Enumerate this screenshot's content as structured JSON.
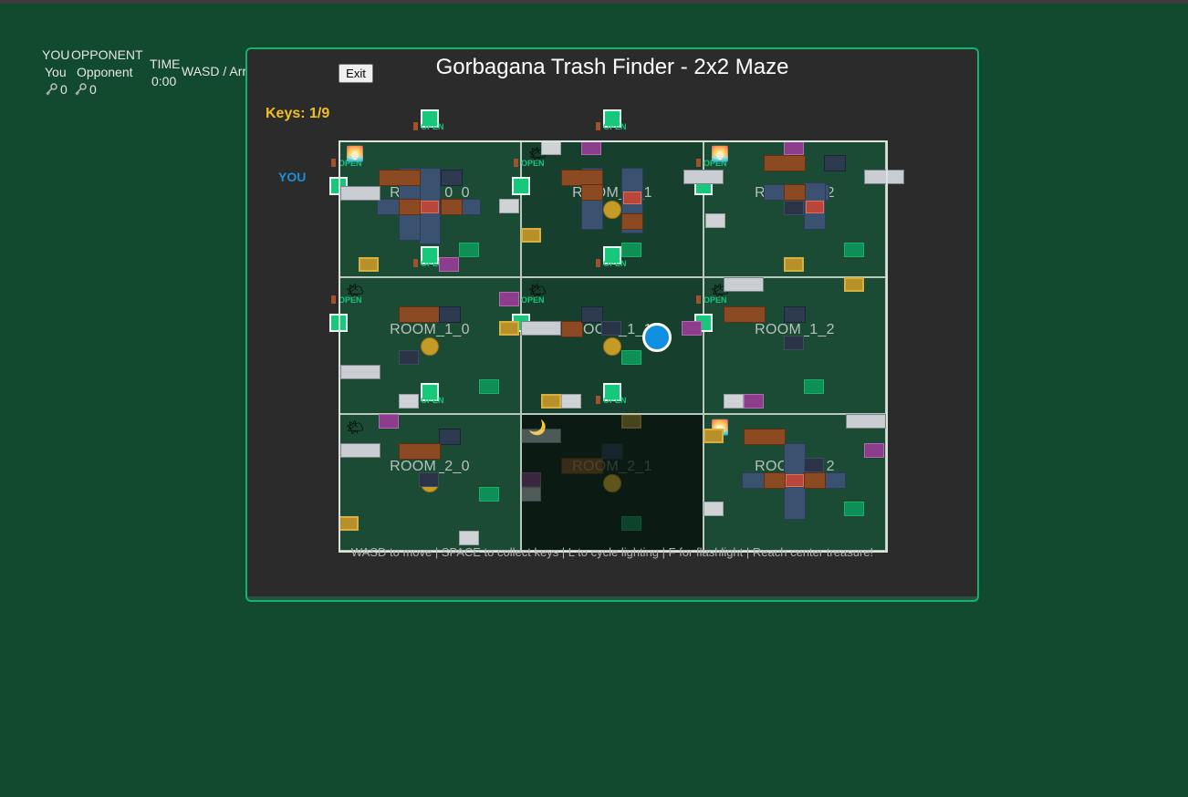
{
  "hud": {
    "you_label": "YOU",
    "opponent_label": "OPPONENT",
    "you_name": "You",
    "opponent_name": "Opponent",
    "you_keys": "0",
    "opponent_keys": "0",
    "time_label": "TIME",
    "time_value": "0:00",
    "controls_hint": "WASD / Arrows to move",
    "exit_label": "Exit"
  },
  "game": {
    "title": "Gorbagana Trash Finder - 2x2 Maze",
    "keys_status": "Keys: 1/9",
    "player_label": "YOU",
    "door_label": "OPEN",
    "instructions": "WASD to move | SPACE to collect keys | L to cycle lighting | F for flashlight | Reach center treasure!",
    "rooms": [
      {
        "name": "ROOM_0_0"
      },
      {
        "name": "ROOM_0_1"
      },
      {
        "name": "ROOM_0_2"
      },
      {
        "name": "ROOM_1_0"
      },
      {
        "name": "ROOM_1_1"
      },
      {
        "name": "ROOM_1_2"
      },
      {
        "name": "ROOM_2_0"
      },
      {
        "name": "ROOM_2_1"
      },
      {
        "name": "ROOM_2_2"
      }
    ]
  },
  "colors": {
    "background": "#124a30",
    "accent": "#13b26d",
    "keys_text": "#f0c021",
    "player": "#0e8fe0"
  },
  "icons": [
    "key-icon",
    "sun-icon",
    "moon-icon",
    "door-icon",
    "painting-icon",
    "lamp-icon",
    "computer-icon",
    "trash-bin-icon",
    "bookshelf-icon",
    "desk-icon",
    "chair-icon"
  ]
}
